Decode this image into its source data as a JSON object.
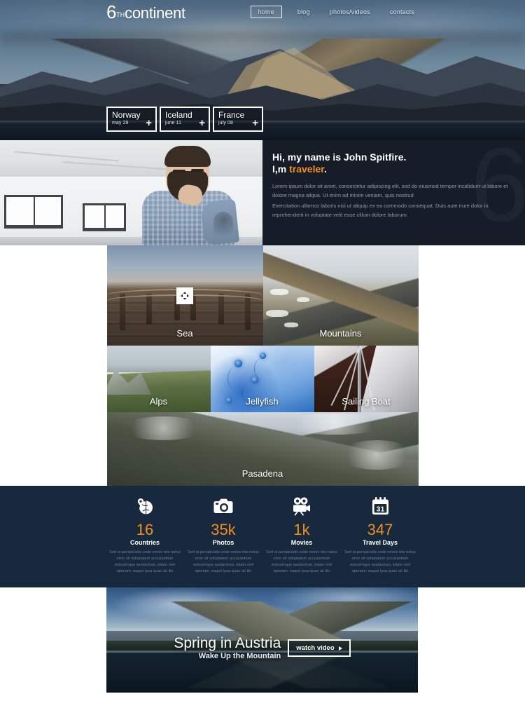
{
  "brand": {
    "logo_number": "6",
    "logo_suffix": "TH",
    "logo_word": "continent"
  },
  "nav": {
    "items": [
      {
        "label": "home",
        "active": true
      },
      {
        "label": "blog",
        "active": false
      },
      {
        "label": "photos/videos",
        "active": false
      },
      {
        "label": "contacts",
        "active": false
      }
    ]
  },
  "hero": {
    "destinations": [
      {
        "name": "Norway",
        "date": "may 29",
        "add_icon": "plus-icon"
      },
      {
        "name": "Iceland",
        "date": "june 11",
        "add_icon": "plus-icon"
      },
      {
        "name": "France",
        "date": "july 08",
        "add_icon": "plus-icon"
      }
    ]
  },
  "about": {
    "watermark": "6",
    "heading_line1": "Hi, my name is John Spitfire.",
    "heading_line2_pre": "I,m ",
    "heading_accent": "traveler",
    "heading_line2_post": ".",
    "paragraph1": "Lorem ipsum dolor sit amet, consectetur adipiscing elit, sed do eiusmod tempor incididunt ut labore et dolore magna aliqua. Ut enim ad minim veniam, quis nostrud",
    "paragraph2": "Exercitation ullamco laboris nisi ut aliquip ex ea commodo consequat. Duis aute irure dolor in reprehenderit in voluptate velit esse cillum dolore laborum.",
    "accent_color": "#f0901e",
    "panel_color": "#161d29"
  },
  "gallery": {
    "expand_icon": "expand-arrows-icon",
    "row1": [
      {
        "label": "Sea",
        "has_expand": true
      },
      {
        "label": "Mountains",
        "has_expand": false
      }
    ],
    "row2": [
      {
        "label": "Alps"
      },
      {
        "label": "Jellyfish"
      },
      {
        "label": "Sailing Boat"
      }
    ],
    "row3": [
      {
        "label": "Pasadena"
      }
    ]
  },
  "stats": {
    "background_color": "#18293d",
    "accent_color": "#f0901e",
    "description": "Sed ut perspiciatis unde omnis iste natus error sit voluptatem accusantium doloremque laudantium, totam rem aperiam, eaque ipsa quae ab illo",
    "items": [
      {
        "icon": "globe-pin-icon",
        "value": "16",
        "label": "Countries"
      },
      {
        "icon": "camera-icon",
        "value": "35k",
        "label": "Photos"
      },
      {
        "icon": "movie-camera-icon",
        "value": "1k",
        "label": "Movies"
      },
      {
        "icon": "calendar-icon",
        "value": "347",
        "label": "Travel Days",
        "calendar_day": "31"
      }
    ]
  },
  "video": {
    "title": "Spring in Austria",
    "subtitle": "Wake Up the Mountain",
    "button_label": "watch video",
    "button_icon": "play-triangle-icon"
  }
}
